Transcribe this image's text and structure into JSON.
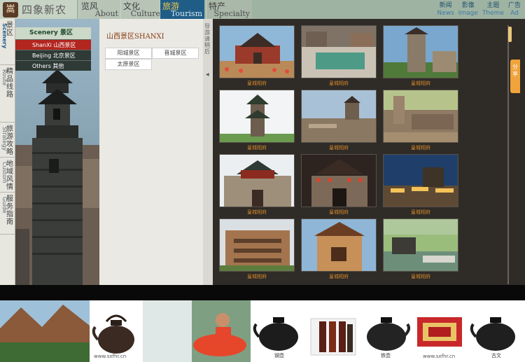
{
  "header": {
    "logo_seal": "嵩",
    "logo_text": "四象新农",
    "nav": [
      {
        "zh": "览风",
        "en": "About"
      },
      {
        "zh": "文化",
        "en": "Culture"
      },
      {
        "zh": "旅游",
        "en": "Tourism"
      },
      {
        "zh": "特产",
        "en": "Specialty"
      }
    ],
    "quick_links": [
      {
        "zh": "新闻",
        "en": "News"
      },
      {
        "zh": "影像",
        "en": "Image"
      },
      {
        "zh": "主题",
        "en": "Theme"
      },
      {
        "zh": "广告",
        "en": "Ad"
      }
    ]
  },
  "side_tabs": [
    {
      "zh": "景区",
      "en": "Scenery"
    },
    {
      "zh": "精品线路",
      "en": "Route"
    },
    {
      "zh": "旅游攻略",
      "en": "Strategy"
    },
    {
      "zh": "地域风情",
      "en": "Custom"
    },
    {
      "zh": "服务指南",
      "en": "Guide"
    }
  ],
  "scenery_menu": {
    "title": "Scenery  景区",
    "items": [
      {
        "label": "ShanXi 山西景区",
        "active": true
      },
      {
        "label": "Beijing 北京景区",
        "active": false
      },
      {
        "label": "Others 其他",
        "active": false
      }
    ]
  },
  "middle": {
    "title": "山西景区SHANXI",
    "links": [
      "阳城景区",
      "晋城景区",
      "太原景区"
    ]
  },
  "sidecol": {
    "text": "导游请稍后"
  },
  "share": {
    "label": "分享"
  },
  "gallery": {
    "items": [
      {
        "caption": "皇城相府"
      },
      {
        "caption": "皇城相府"
      },
      {
        "caption": "皇城相府"
      },
      {
        "caption": "皇城相府"
      },
      {
        "caption": "皇城相府"
      },
      {
        "caption": "皇城相府"
      },
      {
        "caption": "皇城相府"
      },
      {
        "caption": "皇城相府"
      },
      {
        "caption": "皇城相府"
      },
      {
        "caption": "皇城相府"
      },
      {
        "caption": "皇城相府"
      },
      {
        "caption": "皇城相府"
      }
    ]
  },
  "banner": {
    "watermark": "www.sxfhr.cn",
    "captions": [
      "钢壶",
      "铁壶",
      "古文"
    ]
  },
  "colors": {
    "tourism_nav": "#1f5d86",
    "menu_active": "#b3251f",
    "caption": "#d48a2b",
    "gallery_bg": "#2f2b27"
  }
}
